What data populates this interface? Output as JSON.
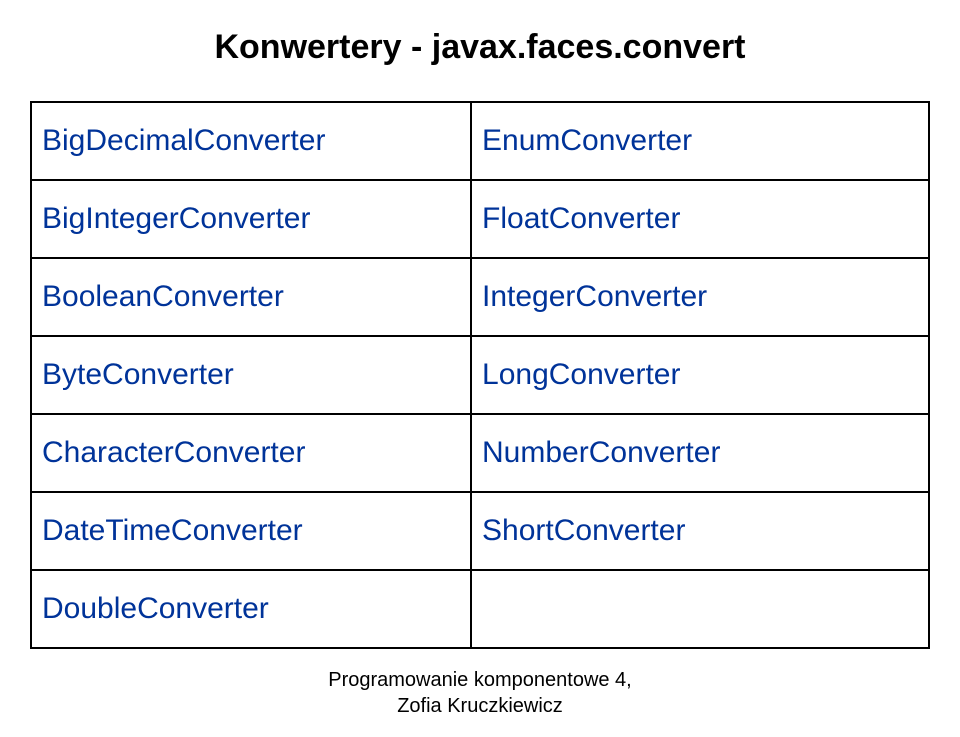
{
  "title": "Konwertery - javax.faces.convert",
  "table": {
    "rows": [
      {
        "left": "BigDecimalConverter",
        "right": "EnumConverter"
      },
      {
        "left": "BigIntegerConverter",
        "right": "FloatConverter"
      },
      {
        "left": "BooleanConverter",
        "right": "IntegerConverter"
      },
      {
        "left": "ByteConverter",
        "right": "LongConverter"
      },
      {
        "left": "CharacterConverter",
        "right": "NumberConverter"
      },
      {
        "left": "DateTimeConverter",
        "right": "ShortConverter"
      },
      {
        "left": "DoubleConverter",
        "right": ""
      }
    ]
  },
  "footer": {
    "line1": "Programowanie komponentowe 4,",
    "line2": "Zofia Kruczkiewicz"
  }
}
